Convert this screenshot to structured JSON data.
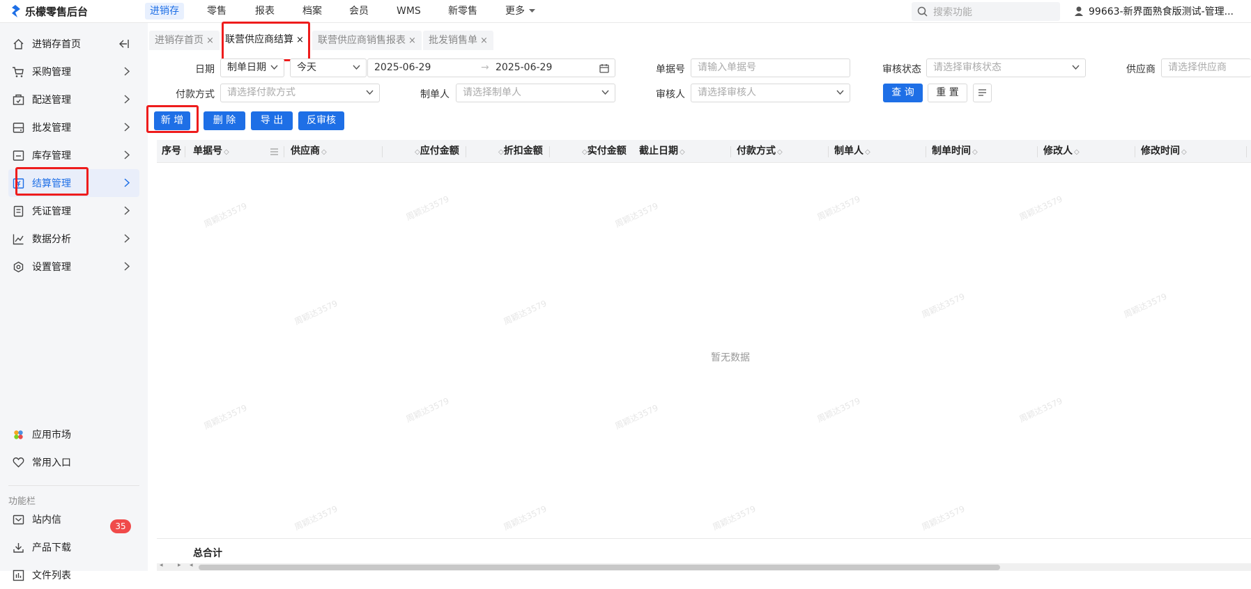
{
  "app": {
    "title": "乐檬零售后台"
  },
  "topnav": {
    "items": [
      {
        "label": "进销存",
        "active": true
      },
      {
        "label": "零售"
      },
      {
        "label": "报表"
      },
      {
        "label": "档案"
      },
      {
        "label": "会员"
      },
      {
        "label": "WMS"
      },
      {
        "label": "新零售"
      },
      {
        "label": "更多"
      }
    ],
    "search_placeholder": "搜索功能",
    "store": "99663-新界面熟食版测试-管理..."
  },
  "sidebar": {
    "items": [
      {
        "label": "进销存首页",
        "icon": "home-icon"
      },
      {
        "label": "采购管理",
        "icon": "cart-icon"
      },
      {
        "label": "配送管理",
        "icon": "delivery-icon"
      },
      {
        "label": "批发管理",
        "icon": "wholesale-icon"
      },
      {
        "label": "库存管理",
        "icon": "inventory-icon"
      },
      {
        "label": "结算管理",
        "icon": "settlement-icon",
        "active": true
      },
      {
        "label": "凭证管理",
        "icon": "voucher-icon"
      },
      {
        "label": "数据分析",
        "icon": "chart-icon"
      },
      {
        "label": "设置管理",
        "icon": "settings-icon"
      }
    ],
    "bottom": [
      {
        "label": "应用市场",
        "icon": "app-market-icon"
      },
      {
        "label": "常用入口",
        "icon": "heart-icon"
      }
    ],
    "func_label": "功能栏",
    "func_items": [
      {
        "label": "站内信",
        "icon": "mail-icon",
        "badge": "35"
      },
      {
        "label": "产品下载",
        "icon": "download-icon"
      },
      {
        "label": "文件列表",
        "icon": "file-list-icon"
      }
    ]
  },
  "tabs": [
    {
      "label": "进销存首页"
    },
    {
      "label": "联营供应商结算",
      "active": true
    },
    {
      "label": "联营供应商销售报表"
    },
    {
      "label": "批发销售单"
    }
  ],
  "filters": {
    "date_label": "日期",
    "date_type": "制单日期",
    "date_range": "今天",
    "date_start": "2025-06-29",
    "date_end": "2025-06-29",
    "doc_no_label": "单据号",
    "doc_no_placeholder": "请输入单据号",
    "audit_status_label": "审核状态",
    "audit_status_placeholder": "请选择审核状态",
    "supplier_label": "供应商",
    "supplier_placeholder": "请选择供应商",
    "payment_label": "付款方式",
    "payment_placeholder": "请选择付款方式",
    "maker_label": "制单人",
    "maker_placeholder": "请选择制单人",
    "auditor_label": "审核人",
    "auditor_placeholder": "请选择审核人",
    "query_label": "查 询",
    "reset_label": "重 置"
  },
  "actions": {
    "add": "新 增",
    "delete": "删 除",
    "export": "导 出",
    "unaudit": "反审核"
  },
  "table": {
    "columns": [
      "序号",
      "单据号",
      "供应商",
      "应付金额",
      "折扣金额",
      "实付金额",
      "截止日期",
      "付款方式",
      "制单人",
      "制单时间",
      "修改人",
      "修改时间"
    ],
    "empty_text": "暂无数据",
    "total_label": "总合计"
  },
  "watermark": "周颖达3579",
  "colors": {
    "accent": "#1e6fe6",
    "highlight": "#ee1c1c",
    "badge": "#f04a4a"
  }
}
